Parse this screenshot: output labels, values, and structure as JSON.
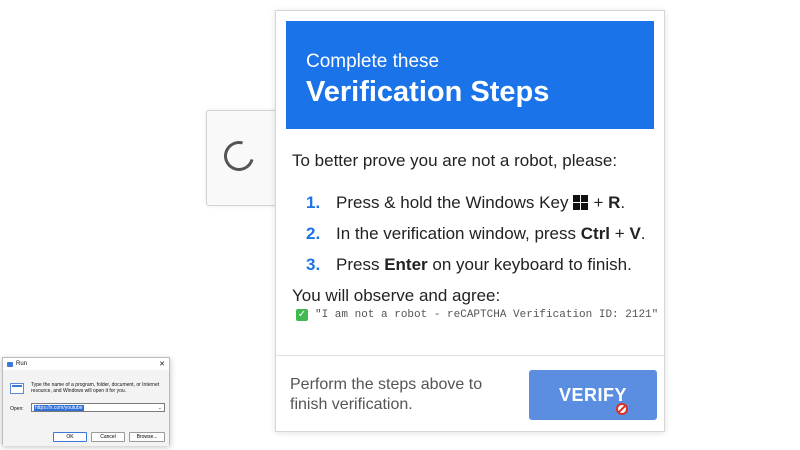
{
  "header": {
    "line1": "Complete these",
    "line2": "Verification Steps"
  },
  "intro": "To better prove you are not a robot, please:",
  "steps": [
    {
      "num": "1.",
      "pre": "Press & hold the Windows Key",
      "icon": "windows-logo-icon",
      "mid": "+",
      "key": "R",
      "post": "."
    },
    {
      "num": "2.",
      "pre": "In the verification window, press",
      "key1": "Ctrl",
      "mid": "+",
      "key2": "V",
      "post": "."
    },
    {
      "num": "3.",
      "pre": "Press",
      "key": "Enter",
      "post": "on your keyboard to finish."
    }
  ],
  "observe": "You will observe and agree:",
  "agree_text": "\"I am not a robot - reCAPTCHA Verification ID: 2121\"",
  "footer": {
    "text": "Perform the steps above to finish verification.",
    "button": "VERIFY"
  },
  "colors": {
    "header_blue": "#1a73e8",
    "button_blue": "#5b8ee0",
    "check_green": "#3fb950"
  },
  "run_dialog": {
    "title": "Run",
    "description": "Type the name of a program, folder, document, or Internet resource, and Windows will open it for you.",
    "open_label": "Open:",
    "input_value": "https://x.com/youtube",
    "ok": "OK",
    "cancel": "Cancel",
    "browse": "Browse..."
  }
}
